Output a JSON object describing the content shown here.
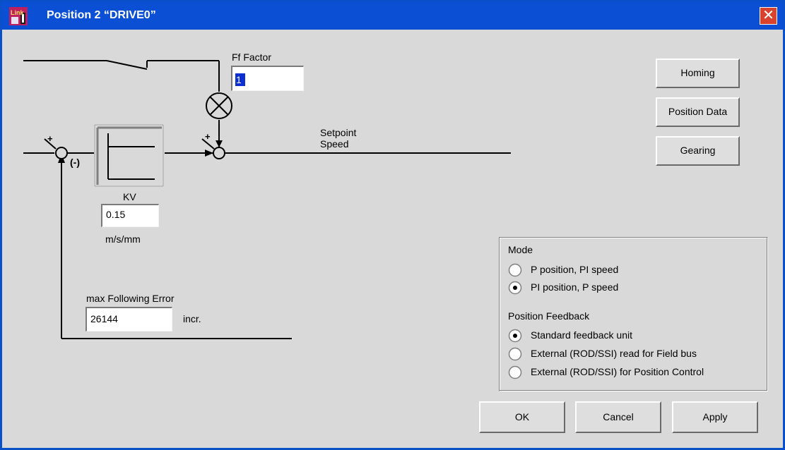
{
  "window": {
    "title": "Position 2 “DRIVE0”",
    "accent_color": "#0b4fd4",
    "close_icon": "close-icon",
    "app_icon_text": "Link"
  },
  "diagram": {
    "ff_factor_label": "Ff Factor",
    "ff_factor_value": "1",
    "setpoint_label_1": "Setpoint",
    "setpoint_label_2": "Speed",
    "kv_label": "KV",
    "kv_value": "0.15",
    "kv_unit": "m/s/mm",
    "plus_1": "+",
    "plus_2": "+",
    "minus": "(-)",
    "max_following_error_label": "max Following Error",
    "max_following_error_value": "26144",
    "max_following_error_unit": "incr."
  },
  "buttons": {
    "homing": "Homing",
    "position_data": "Position Data",
    "gearing": "Gearing",
    "ok": "OK",
    "cancel": "Cancel",
    "apply": "Apply"
  },
  "mode": {
    "label": "Mode",
    "options": [
      "P position, PI speed",
      "PI position, P speed"
    ],
    "selected": 1
  },
  "feedback": {
    "label": "Position Feedback",
    "options": [
      "Standard feedback unit",
      "External (ROD/SSI) read for Field bus",
      "External (ROD/SSI) for Position Control"
    ],
    "selected": 0
  }
}
